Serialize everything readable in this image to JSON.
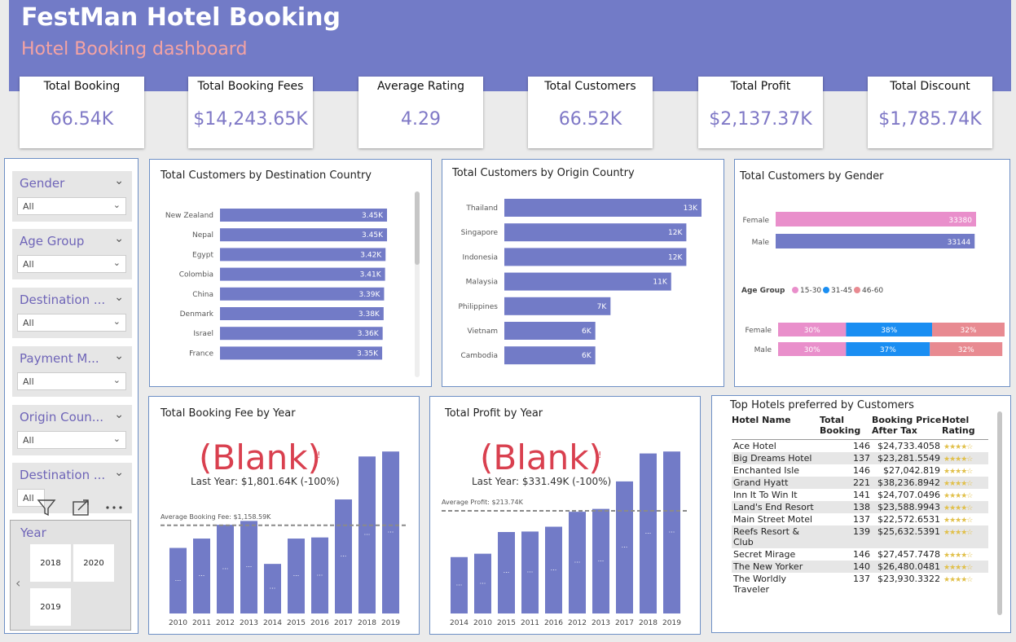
{
  "header": {
    "title": "FestMan Hotel Booking",
    "subtitle": "Hotel Booking dashboard"
  },
  "kpis": [
    {
      "label": "Total Booking",
      "value": "66.54K"
    },
    {
      "label": "Total Booking Fees",
      "value": "$14,243.65K"
    },
    {
      "label": "Average Rating",
      "value": "4.29"
    },
    {
      "label": "Total Customers",
      "value": "66.52K"
    },
    {
      "label": "Total Profit",
      "value": "$2,137.37K"
    },
    {
      "label": "Total Discount",
      "value": "$1,785.74K"
    }
  ],
  "slicers": [
    {
      "label": "Gender",
      "value": "All"
    },
    {
      "label": "Age Group",
      "value": "All"
    },
    {
      "label": "Destination ...",
      "value": "All"
    },
    {
      "label": "Payment M...",
      "value": "All"
    },
    {
      "label": "Origin Coun...",
      "value": "All"
    },
    {
      "label": "Destination ...",
      "value": "All"
    }
  ],
  "year_slicer": {
    "label": "Year",
    "tiles": [
      "2018",
      "2020",
      "2019"
    ]
  },
  "colors": {
    "accent": "#727bc7",
    "female": "#e98fcb",
    "age_15_30": "#e98fcb",
    "age_31_45": "#1a8ef2",
    "age_46_60": "#e88a91",
    "blank": "#d9404f"
  },
  "chart_data": [
    {
      "id": "dest",
      "type": "bar",
      "title": "Total Customers by Destination Country",
      "categories": [
        "New Zealand",
        "Nepal",
        "Egypt",
        "Colombia",
        "China",
        "Denmark",
        "Israel",
        "France"
      ],
      "values": [
        3.45,
        3.45,
        3.42,
        3.41,
        3.39,
        3.38,
        3.36,
        3.35
      ],
      "labels": [
        "3.45K",
        "3.45K",
        "3.42K",
        "3.41K",
        "3.39K",
        "3.38K",
        "3.36K",
        "3.35K"
      ]
    },
    {
      "id": "origin",
      "type": "bar",
      "title": "Total Customers by Origin Country",
      "categories": [
        "Thailand",
        "Singapore",
        "Indonesia",
        "Malaysia",
        "Philippines",
        "Vietnam",
        "Cambodia"
      ],
      "values": [
        13,
        12,
        12,
        11,
        7,
        6,
        6
      ],
      "labels": [
        "13K",
        "12K",
        "12K",
        "11K",
        "7K",
        "6K",
        "6K"
      ]
    },
    {
      "id": "gender",
      "type": "bar",
      "title": "Total Customers by Gender",
      "categories": [
        "Female",
        "Male"
      ],
      "values": [
        33380,
        33144
      ],
      "labels": [
        "33380",
        "33144"
      ]
    },
    {
      "id": "agegroup",
      "type": "bar",
      "title": "Age Group",
      "legend": [
        "15-30",
        "31-45",
        "46-60"
      ],
      "categories": [
        "Female",
        "Male"
      ],
      "series": [
        {
          "name": "15-30",
          "values": [
            30,
            30
          ]
        },
        {
          "name": "31-45",
          "values": [
            38,
            37
          ]
        },
        {
          "name": "46-60",
          "values": [
            32,
            32
          ]
        }
      ]
    },
    {
      "id": "fee",
      "type": "bar",
      "title": "Total Booking Fee by Year",
      "categories": [
        "2010",
        "2011",
        "2012",
        "2013",
        "2014",
        "2015",
        "2016",
        "2017",
        "2018",
        "2019"
      ],
      "values": [
        1.19,
        1.36,
        1.61,
        1.68,
        0.9,
        1.36,
        1.38,
        2.07,
        2.85,
        2.94
      ],
      "value_label": "...",
      "blank": "(Blank)",
      "last_year": "Last Year: $1,801.64K (-100%)",
      "avg_label": "Average Booking Fee: $1,158.59K",
      "avg": 1.6
    },
    {
      "id": "profit",
      "type": "bar",
      "title": "Total Profit by Year",
      "categories": [
        "2014",
        "2010",
        "2015",
        "2011",
        "2016",
        "2012",
        "2013",
        "2017",
        "2018",
        "2019"
      ],
      "values": [
        1.17,
        1.24,
        1.69,
        1.7,
        1.8,
        2.11,
        2.17,
        2.74,
        3.32,
        3.36
      ],
      "value_label": "...",
      "blank": "(Blank)",
      "last_year": "Last Year: $331.49K (-100%)",
      "avg_label": "Average Profit: $213.74K",
      "avg": 2.13
    }
  ],
  "hotels": {
    "title": "Top Hotels preferred by Customers",
    "headers": [
      "Hotel Name",
      "Total Booking",
      "Booking Price After Tax",
      "Hotel Rating"
    ],
    "rows": [
      [
        "Ace Hotel",
        "146",
        "$24,733.4058"
      ],
      [
        "Big Dreams Hotel",
        "137",
        "$23,281.5549"
      ],
      [
        "Enchanted Isle",
        "146",
        "$27,042.819"
      ],
      [
        "Grand Hyatt",
        "221",
        "$38,236.8942"
      ],
      [
        "Inn It To Win It",
        "141",
        "$24,707.0496"
      ],
      [
        "Land's End Resort",
        "138",
        "$23,588.9943"
      ],
      [
        "Main Street Motel",
        "137",
        "$22,572.6531"
      ],
      [
        "Reefs Resort & Club",
        "139",
        "$25,632.5391"
      ],
      [
        "Secret Mirage",
        "146",
        "$27,457.7478"
      ],
      [
        "The New Yorker",
        "140",
        "$26,480.0481"
      ],
      [
        "The Worldly Traveler",
        "137",
        "$23,930.3322"
      ]
    ],
    "rating": 4
  }
}
